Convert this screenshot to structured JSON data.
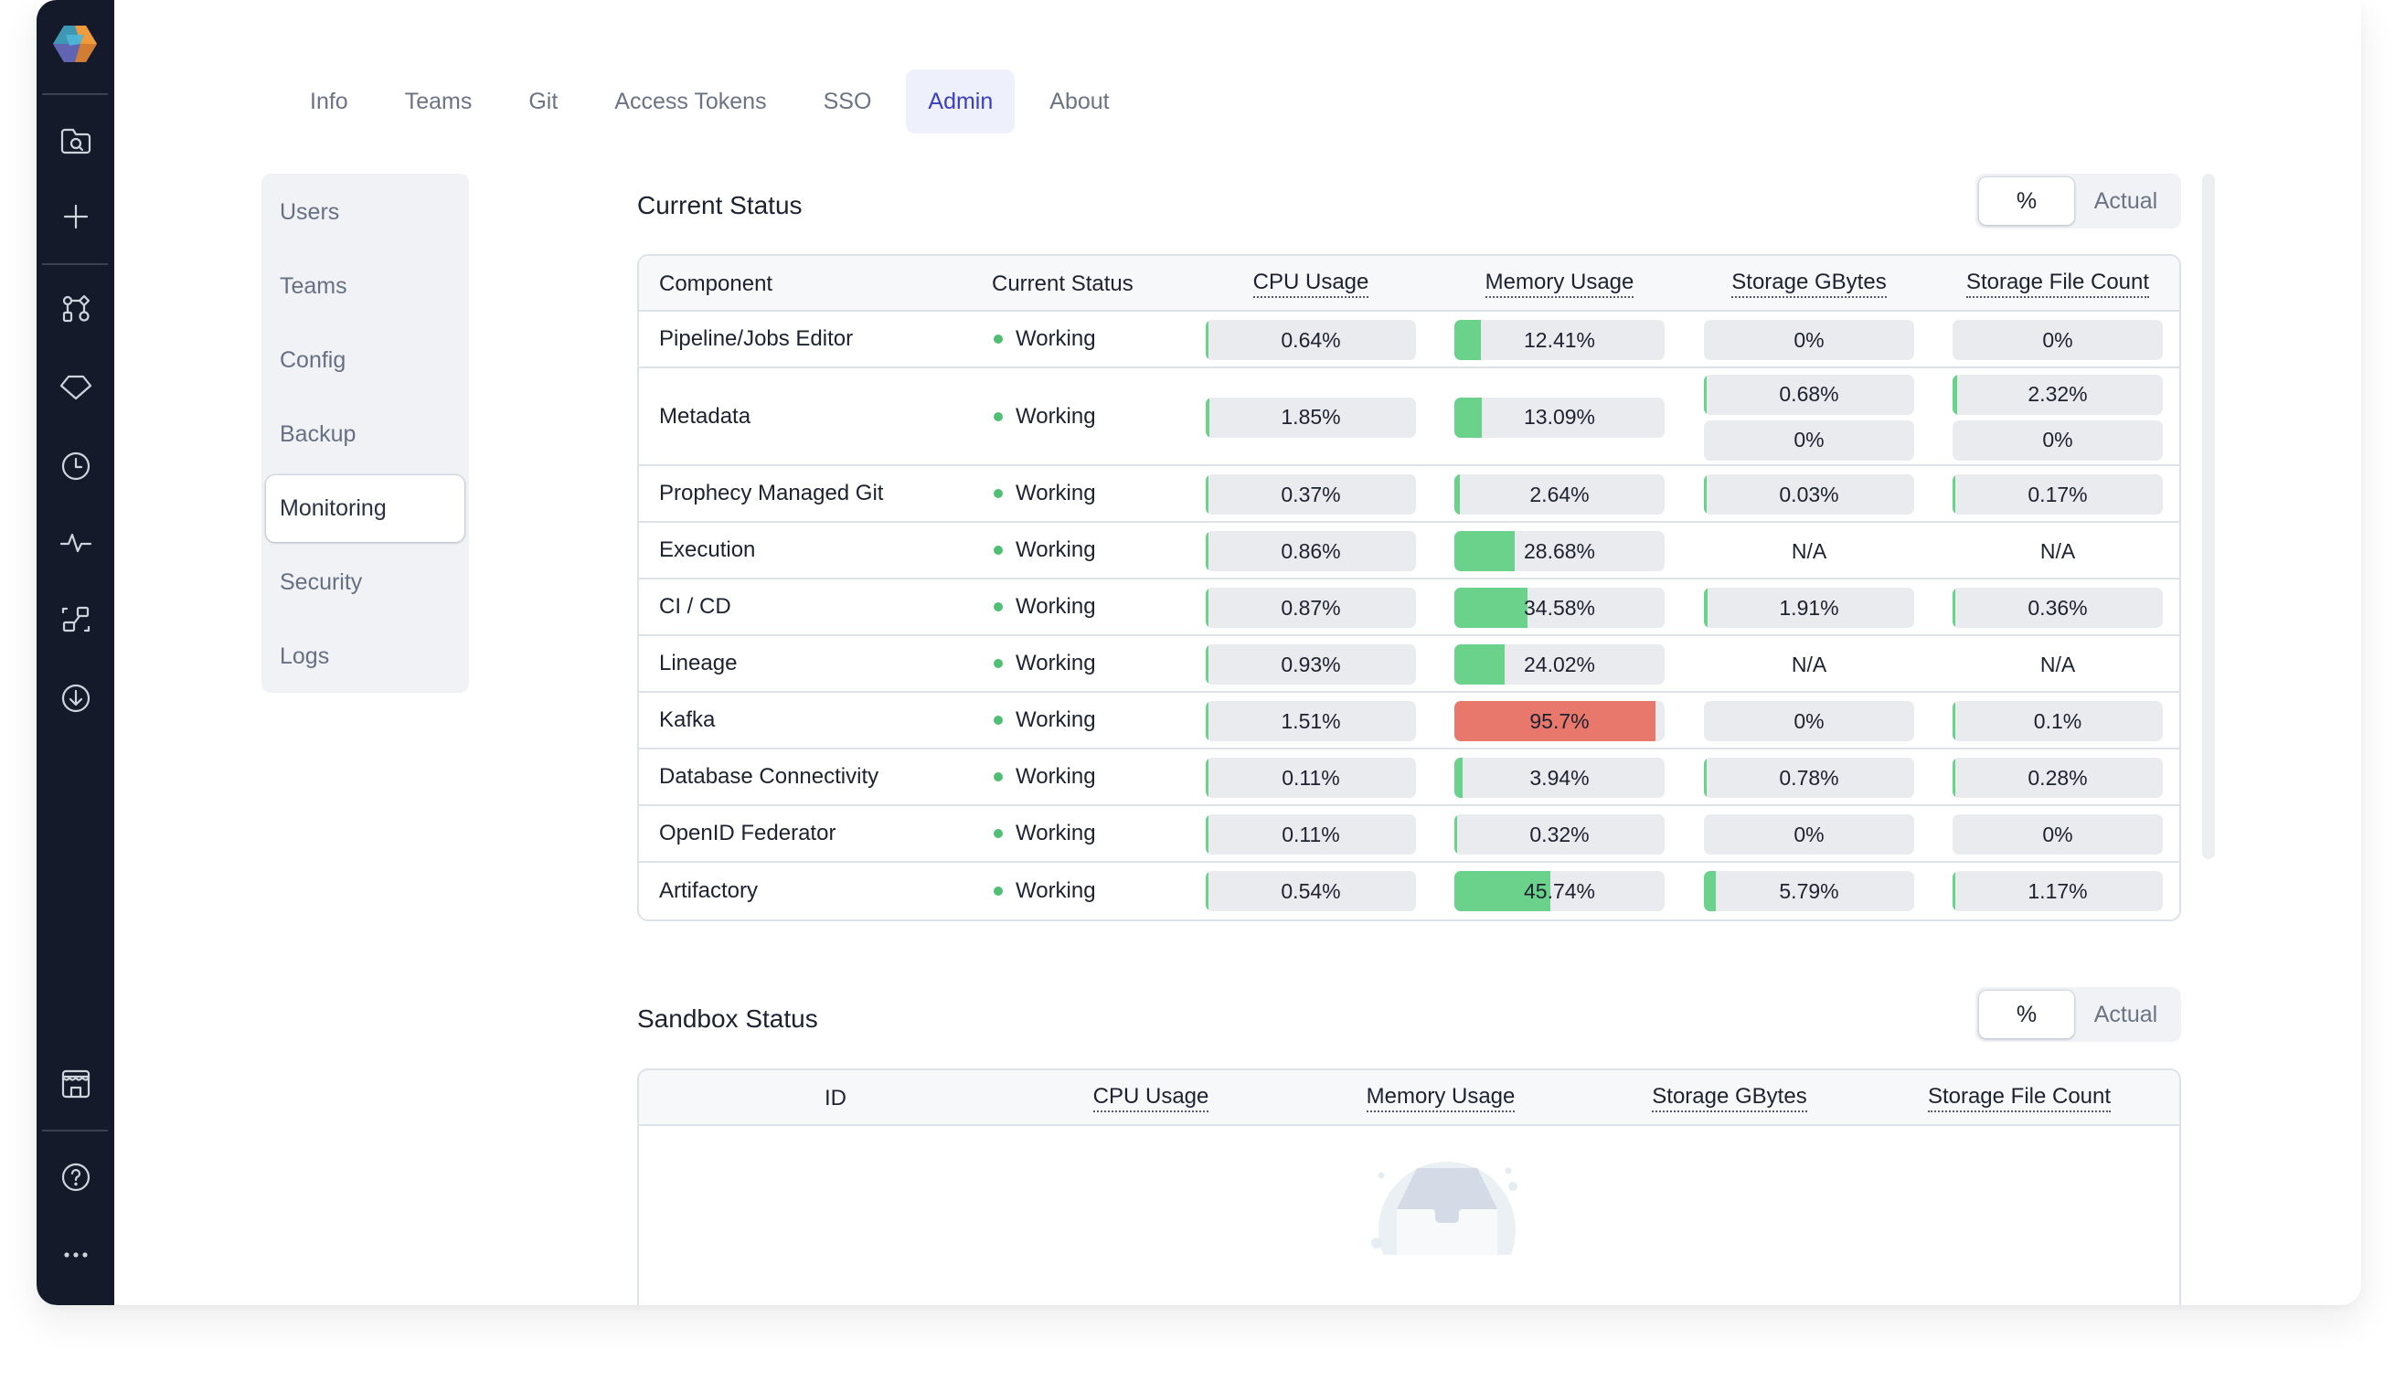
{
  "appbar": {
    "logo": "prophecy-logo-icon",
    "items": [
      {
        "icon": "folder-search-icon",
        "label": "Browse"
      },
      {
        "icon": "plus-icon",
        "label": "Create"
      },
      {
        "icon": "git-graph-icon",
        "label": "Pipelines"
      },
      {
        "icon": "diamond-icon",
        "label": "Gems"
      },
      {
        "icon": "clock-icon",
        "label": "Jobs"
      },
      {
        "icon": "pulse-icon",
        "label": "Observability"
      },
      {
        "icon": "lineage-icon",
        "label": "Lineage"
      },
      {
        "icon": "download-icon",
        "label": "Install"
      },
      {
        "icon": "marketplace-icon",
        "label": "Marketplace"
      },
      {
        "icon": "help-icon",
        "label": "Help"
      },
      {
        "icon": "more-icon",
        "label": "More"
      }
    ]
  },
  "tabs": [
    {
      "label": "Info",
      "active": false
    },
    {
      "label": "Teams",
      "active": false
    },
    {
      "label": "Git",
      "active": false
    },
    {
      "label": "Access Tokens",
      "active": false
    },
    {
      "label": "SSO",
      "active": false
    },
    {
      "label": "Admin",
      "active": true
    },
    {
      "label": "About",
      "active": false
    }
  ],
  "subnav": [
    {
      "label": "Users",
      "active": false
    },
    {
      "label": "Teams",
      "active": false
    },
    {
      "label": "Config",
      "active": false
    },
    {
      "label": "Backup",
      "active": false
    },
    {
      "label": "Monitoring",
      "active": true
    },
    {
      "label": "Security",
      "active": false
    },
    {
      "label": "Logs",
      "active": false
    }
  ],
  "colors": {
    "ok": "#6bd28b",
    "danger": "#e8776c",
    "status_dot": "#4fbf73",
    "accent": "#3b3fbf"
  },
  "current_status": {
    "title": "Current Status",
    "toggle": {
      "percent_label": "%",
      "actual_label": "Actual",
      "selected": "%"
    },
    "columns": [
      "Component",
      "Current Status",
      "CPU Usage",
      "Memory Usage",
      "Storage GBytes",
      "Storage File Count"
    ],
    "rows": [
      {
        "component": "Pipeline/Jobs Editor",
        "status": "Working",
        "cpu": [
          0.64
        ],
        "memory": [
          12.41
        ],
        "storage_gb": [
          0
        ],
        "file_count": [
          0
        ]
      },
      {
        "component": "Metadata",
        "status": "Working",
        "cpu": [
          1.85
        ],
        "memory": [
          13.09
        ],
        "storage_gb": [
          0.68,
          0
        ],
        "file_count": [
          2.32,
          0
        ]
      },
      {
        "component": "Prophecy Managed Git",
        "status": "Working",
        "cpu": [
          0.37
        ],
        "memory": [
          2.64
        ],
        "storage_gb": [
          0.03
        ],
        "file_count": [
          0.17
        ]
      },
      {
        "component": "Execution",
        "status": "Working",
        "cpu": [
          0.86
        ],
        "memory": [
          28.68
        ],
        "storage_gb": "N/A",
        "file_count": "N/A"
      },
      {
        "component": "CI / CD",
        "status": "Working",
        "cpu": [
          0.87
        ],
        "memory": [
          34.58
        ],
        "storage_gb": [
          1.91
        ],
        "file_count": [
          0.36
        ]
      },
      {
        "component": "Lineage",
        "status": "Working",
        "cpu": [
          0.93
        ],
        "memory": [
          24.02
        ],
        "storage_gb": "N/A",
        "file_count": "N/A"
      },
      {
        "component": "Kafka",
        "status": "Working",
        "cpu": [
          1.51
        ],
        "memory": [
          95.7
        ],
        "storage_gb": [
          0
        ],
        "file_count": [
          0.1
        ]
      },
      {
        "component": "Database Connectivity",
        "status": "Working",
        "cpu": [
          0.11
        ],
        "memory": [
          3.94
        ],
        "storage_gb": [
          0.78
        ],
        "file_count": [
          0.28
        ]
      },
      {
        "component": "OpenID Federator",
        "status": "Working",
        "cpu": [
          0.11
        ],
        "memory": [
          0.32
        ],
        "storage_gb": [
          0
        ],
        "file_count": [
          0
        ]
      },
      {
        "component": "Artifactory",
        "status": "Working",
        "cpu": [
          0.54
        ],
        "memory": [
          45.74
        ],
        "storage_gb": [
          5.79
        ],
        "file_count": [
          1.17
        ]
      }
    ],
    "danger_threshold": 90
  },
  "sandbox_status": {
    "title": "Sandbox Status",
    "toggle": {
      "percent_label": "%",
      "actual_label": "Actual",
      "selected": "%"
    },
    "columns": [
      "ID",
      "CPU Usage",
      "Memory Usage",
      "Storage GBytes",
      "Storage File Count"
    ],
    "rows": [],
    "empty_icon": "empty-inbox-icon"
  }
}
